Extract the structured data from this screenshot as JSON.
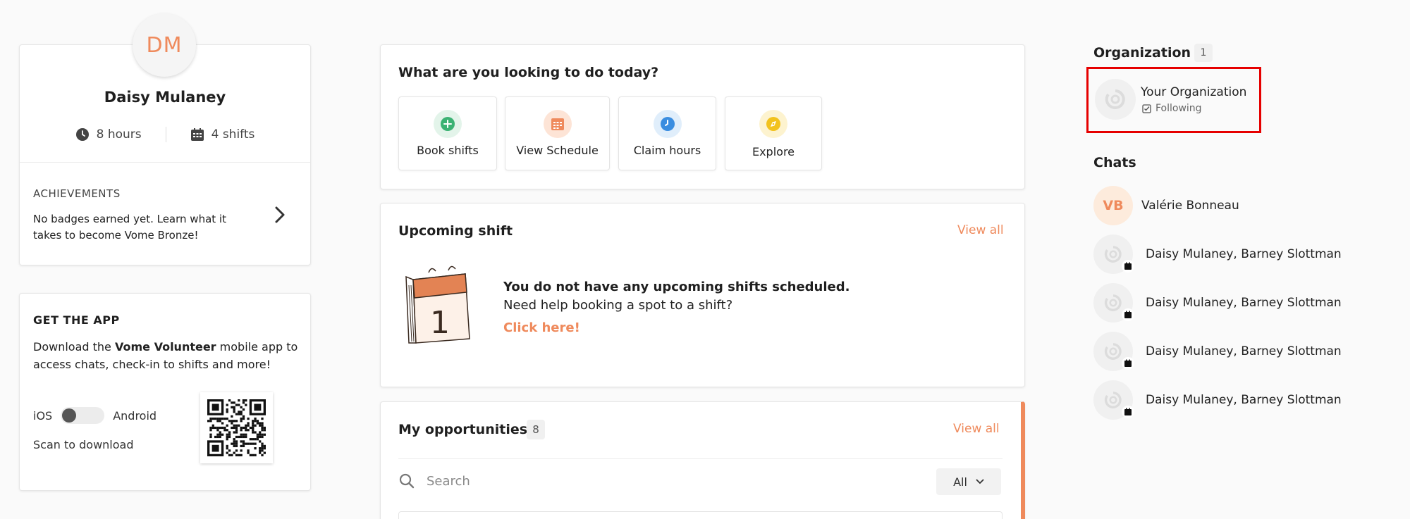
{
  "profile": {
    "initials": "DM",
    "name": "Daisy Mulaney",
    "hours": "8 hours",
    "shifts": "4 shifts",
    "achievements_title": "ACHIEVEMENTS",
    "achievements_text": "No badges earned yet. Learn what it takes to become Vome Bronze!"
  },
  "get_app": {
    "title": "GET THE APP",
    "desc_prefix": "Download the ",
    "desc_app": "Vome Volunteer",
    "desc_suffix": " mobile app to access chats, check-in to shifts and more!",
    "ios_label": "iOS",
    "android_label": "Android",
    "scan_label": "Scan to download"
  },
  "todo": {
    "title": "What are you looking to do today?",
    "tiles": [
      {
        "label": "Book shifts",
        "icon": "plus-icon",
        "color": "#3bb273",
        "bg": "#e3f4ea"
      },
      {
        "label": "View Schedule",
        "icon": "calendar-icon",
        "color": "#ef8a5c",
        "bg": "#fde4d6"
      },
      {
        "label": "Claim hours",
        "icon": "clock-icon",
        "color": "#3a8de0",
        "bg": "#e0eefb"
      },
      {
        "label": "Explore",
        "icon": "compass-icon",
        "color": "#f2c21d",
        "bg": "#fdf3cf"
      }
    ]
  },
  "upcoming": {
    "title": "Upcoming shift",
    "view_all": "View all",
    "empty_bold": "You do not have any upcoming shifts scheduled.",
    "empty_sub": "Need help booking a spot to a shift?",
    "empty_link": "Click here!",
    "calendar_digit": "1"
  },
  "opportunities": {
    "title": "My opportunities",
    "count": "8",
    "view_all": "View all",
    "search_placeholder": "Search",
    "filter": "All"
  },
  "organization": {
    "title": "Organization",
    "count": "1",
    "name": "Your Organization",
    "status": "Following"
  },
  "chats": {
    "title": "Chats",
    "items": [
      {
        "initials": "VB",
        "name": "Valérie Bonneau"
      },
      {
        "name": "Daisy Mulaney, Barney Slottman"
      },
      {
        "name": "Daisy Mulaney, Barney Slottman"
      },
      {
        "name": "Daisy Mulaney, Barney Slottman"
      },
      {
        "name": "Daisy Mulaney, Barney Slottman"
      }
    ]
  },
  "colors": {
    "accent": "#ef8a5c",
    "highlight_box": "#e60000"
  }
}
